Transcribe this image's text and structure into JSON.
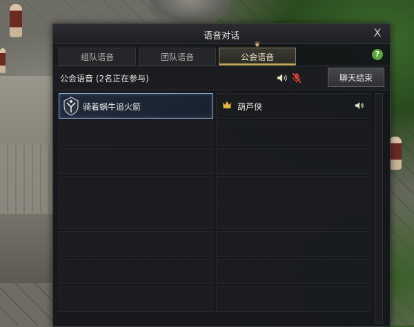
{
  "dialog": {
    "title": "语音对话",
    "close_symbol": "X"
  },
  "tabs": [
    {
      "label": "组队语音",
      "active": false
    },
    {
      "label": "团队语音",
      "active": false
    },
    {
      "label": "公会语音",
      "active": true
    }
  ],
  "help": {
    "symbol": "?"
  },
  "subheader": {
    "channel_label": "公会语音 (2名正在参与)",
    "speaker_icon": "speaker-icon",
    "mic_icon": "mic-muted-icon",
    "end_chat_label": "聊天结束"
  },
  "members": [
    {
      "name": "骑着蜗牛追火箭",
      "icon": "guild-emblem-icon",
      "selected": true,
      "speaking": false
    },
    {
      "name": "葫芦侠",
      "icon": "crown-icon",
      "selected": false,
      "speaking": true
    }
  ],
  "colors": {
    "accent_gold": "#c7a85c",
    "mic_muted": "#c0392b",
    "help_green": "#5aa43a",
    "selected_border": "#8aa5c9"
  }
}
